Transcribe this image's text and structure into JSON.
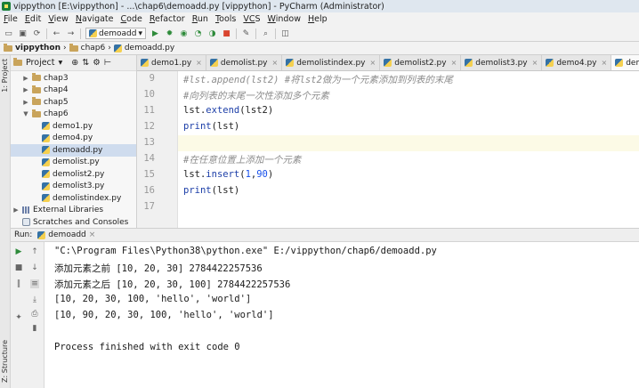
{
  "window": {
    "title": "vippython [E:\\vippython] - ...\\chap6\\demoadd.py [vippython] - PyCharm (Administrator)"
  },
  "menu": [
    {
      "key": "F",
      "rest": "ile"
    },
    {
      "key": "E",
      "rest": "dit"
    },
    {
      "key": "V",
      "rest": "iew"
    },
    {
      "key": "N",
      "rest": "avigate"
    },
    {
      "key": "C",
      "rest": "ode"
    },
    {
      "key": "R",
      "rest": "efactor"
    },
    {
      "key": "R",
      "rest": "un"
    },
    {
      "key": "T",
      "rest": "ools"
    },
    {
      "key": "VC",
      "rest": "S"
    },
    {
      "key": "W",
      "rest": "indow"
    },
    {
      "key": "H",
      "rest": "elp"
    }
  ],
  "toolbar": {
    "run_config": "demoadd"
  },
  "breadcrumbs": [
    "vippython",
    "chap6",
    "demoadd.py"
  ],
  "left_strip": {
    "project_tab": "1: Project",
    "structure_tab": "Z: Structure"
  },
  "project": {
    "header": "Project",
    "tree": [
      {
        "label": "chap3",
        "kind": "folder",
        "arrow": "▶",
        "indent": 1
      },
      {
        "label": "chap4",
        "kind": "folder",
        "arrow": "▶",
        "indent": 1
      },
      {
        "label": "chap5",
        "kind": "folder",
        "arrow": "▶",
        "indent": 1
      },
      {
        "label": "chap6",
        "kind": "folder",
        "arrow": "▼",
        "indent": 1
      },
      {
        "label": "demo1.py",
        "kind": "py",
        "indent": 2
      },
      {
        "label": "demo4.py",
        "kind": "py",
        "indent": 2
      },
      {
        "label": "demoadd.py",
        "kind": "py",
        "indent": 2,
        "selected": true
      },
      {
        "label": "demolist.py",
        "kind": "py",
        "indent": 2
      },
      {
        "label": "demolist2.py",
        "kind": "py",
        "indent": 2
      },
      {
        "label": "demolist3.py",
        "kind": "py",
        "indent": 2
      },
      {
        "label": "demolistindex.py",
        "kind": "py",
        "indent": 2
      },
      {
        "label": "External Libraries",
        "kind": "lib",
        "arrow": "▶",
        "indent": 0
      },
      {
        "label": "Scratches and Consoles",
        "kind": "scratch",
        "indent": 0
      }
    ]
  },
  "tabs": [
    {
      "label": "demo1.py",
      "active": false
    },
    {
      "label": "demolist.py",
      "active": false
    },
    {
      "label": "demolistindex.py",
      "active": false
    },
    {
      "label": "demolist2.py",
      "active": false
    },
    {
      "label": "demolist3.py",
      "active": false
    },
    {
      "label": "demo4.py",
      "active": false
    },
    {
      "label": "demoadd.py",
      "active": true
    }
  ],
  "editor": {
    "lines": [
      {
        "num": "9",
        "parts": [
          {
            "t": "#lst.append(lst2) #将lst2做为一个元素添加到列表的末尾",
            "c": "cmt"
          }
        ]
      },
      {
        "num": "10",
        "parts": [
          {
            "t": "#向列表的末尾一次性添加多个元素",
            "c": "cmt"
          }
        ]
      },
      {
        "num": "11",
        "parts": [
          {
            "t": "lst.",
            "c": ""
          },
          {
            "t": "extend",
            "c": "fn"
          },
          {
            "t": "(lst2)",
            "c": ""
          }
        ]
      },
      {
        "num": "12",
        "parts": [
          {
            "t": "print",
            "c": "fn"
          },
          {
            "t": "(lst)",
            "c": ""
          }
        ]
      },
      {
        "num": "13",
        "parts": []
      },
      {
        "num": "14",
        "parts": [
          {
            "t": "#在任意位置上添加一个元素",
            "c": "cmt"
          }
        ]
      },
      {
        "num": "15",
        "parts": [
          {
            "t": "lst.",
            "c": ""
          },
          {
            "t": "insert",
            "c": "fn"
          },
          {
            "t": "(",
            "c": ""
          },
          {
            "t": "1",
            "c": "num"
          },
          {
            "t": ",",
            "c": ""
          },
          {
            "t": "90",
            "c": "num"
          },
          {
            "t": ")",
            "c": ""
          }
        ]
      },
      {
        "num": "16",
        "parts": [
          {
            "t": "print",
            "c": "fn"
          },
          {
            "t": "(lst)",
            "c": ""
          }
        ]
      },
      {
        "num": "17",
        "parts": []
      }
    ]
  },
  "run": {
    "label": "Run:",
    "config": "demoadd",
    "output": [
      "\"C:\\Program Files\\Python38\\python.exe\" E:/vippython/chap6/demoadd.py",
      "添加元素之前 [10, 20, 30] 2784422257536",
      "添加元素之后 [10, 20, 30, 100] 2784422257536",
      "[10, 20, 30, 100, 'hello', 'world']",
      "[10, 90, 20, 30, 100, 'hello', 'world']",
      "",
      "Process finished with exit code 0"
    ]
  }
}
